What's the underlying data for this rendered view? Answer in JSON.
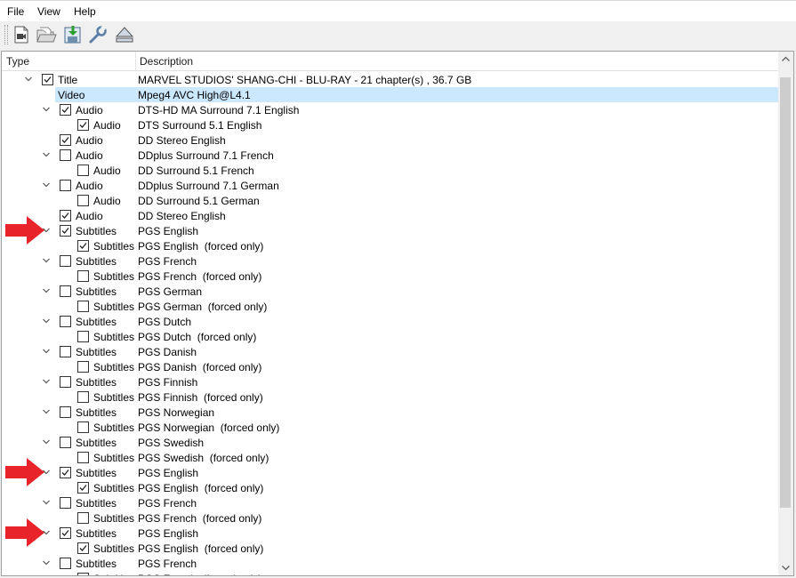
{
  "menubar": {
    "items": [
      {
        "label": "File"
      },
      {
        "label": "View"
      },
      {
        "label": "Help"
      }
    ]
  },
  "toolbar": {
    "buttons": [
      {
        "name": "open-video-file-button",
        "icon": "video-file-icon"
      },
      {
        "name": "open-folder-button",
        "icon": "folder-icon"
      },
      {
        "name": "save-output-button",
        "icon": "save-download-icon"
      },
      {
        "name": "settings-button",
        "icon": "wrench-icon"
      },
      {
        "name": "eject-disc-button",
        "icon": "eject-icon"
      }
    ]
  },
  "tree": {
    "columns": {
      "type": "Type",
      "description": "Description"
    },
    "rows": [
      {
        "level": 0,
        "expander": true,
        "checkbox": true,
        "checked": true,
        "type": "Title",
        "desc": "MARVEL STUDIOS' SHANG-CHI - BLU-RAY - 21 chapter(s) , 36.7 GB"
      },
      {
        "level": 1,
        "expander": false,
        "checkbox": false,
        "checked": false,
        "type": "Video",
        "desc": "Mpeg4 AVC High@L4.1",
        "selected": true
      },
      {
        "level": 1,
        "expander": true,
        "checkbox": true,
        "checked": true,
        "type": "Audio",
        "desc": "DTS-HD MA Surround 7.1 English"
      },
      {
        "level": 2,
        "expander": false,
        "checkbox": true,
        "checked": true,
        "type": "Audio",
        "desc": "DTS Surround 5.1 English"
      },
      {
        "level": 1,
        "expander": false,
        "checkbox": true,
        "checked": true,
        "type": "Audio",
        "desc": "DD Stereo English"
      },
      {
        "level": 1,
        "expander": true,
        "checkbox": true,
        "checked": false,
        "type": "Audio",
        "desc": "DDplus Surround 7.1 French"
      },
      {
        "level": 2,
        "expander": false,
        "checkbox": true,
        "checked": false,
        "type": "Audio",
        "desc": "DD Surround 5.1 French"
      },
      {
        "level": 1,
        "expander": true,
        "checkbox": true,
        "checked": false,
        "type": "Audio",
        "desc": "DDplus Surround 7.1 German"
      },
      {
        "level": 2,
        "expander": false,
        "checkbox": true,
        "checked": false,
        "type": "Audio",
        "desc": "DD Surround 5.1 German"
      },
      {
        "level": 1,
        "expander": false,
        "checkbox": true,
        "checked": true,
        "type": "Audio",
        "desc": "DD Stereo English"
      },
      {
        "level": 1,
        "expander": true,
        "checkbox": true,
        "checked": true,
        "type": "Subtitles",
        "desc": "PGS English"
      },
      {
        "level": 2,
        "expander": false,
        "checkbox": true,
        "checked": true,
        "type": "Subtitles",
        "desc": "PGS English  (forced only)"
      },
      {
        "level": 1,
        "expander": true,
        "checkbox": true,
        "checked": false,
        "type": "Subtitles",
        "desc": "PGS French"
      },
      {
        "level": 2,
        "expander": false,
        "checkbox": true,
        "checked": false,
        "type": "Subtitles",
        "desc": "PGS French  (forced only)"
      },
      {
        "level": 1,
        "expander": true,
        "checkbox": true,
        "checked": false,
        "type": "Subtitles",
        "desc": "PGS German"
      },
      {
        "level": 2,
        "expander": false,
        "checkbox": true,
        "checked": false,
        "type": "Subtitles",
        "desc": "PGS German  (forced only)"
      },
      {
        "level": 1,
        "expander": true,
        "checkbox": true,
        "checked": false,
        "type": "Subtitles",
        "desc": "PGS Dutch"
      },
      {
        "level": 2,
        "expander": false,
        "checkbox": true,
        "checked": false,
        "type": "Subtitles",
        "desc": "PGS Dutch  (forced only)"
      },
      {
        "level": 1,
        "expander": true,
        "checkbox": true,
        "checked": false,
        "type": "Subtitles",
        "desc": "PGS Danish"
      },
      {
        "level": 2,
        "expander": false,
        "checkbox": true,
        "checked": false,
        "type": "Subtitles",
        "desc": "PGS Danish  (forced only)"
      },
      {
        "level": 1,
        "expander": true,
        "checkbox": true,
        "checked": false,
        "type": "Subtitles",
        "desc": "PGS Finnish"
      },
      {
        "level": 2,
        "expander": false,
        "checkbox": true,
        "checked": false,
        "type": "Subtitles",
        "desc": "PGS Finnish  (forced only)"
      },
      {
        "level": 1,
        "expander": true,
        "checkbox": true,
        "checked": false,
        "type": "Subtitles",
        "desc": "PGS Norwegian"
      },
      {
        "level": 2,
        "expander": false,
        "checkbox": true,
        "checked": false,
        "type": "Subtitles",
        "desc": "PGS Norwegian  (forced only)"
      },
      {
        "level": 1,
        "expander": true,
        "checkbox": true,
        "checked": false,
        "type": "Subtitles",
        "desc": "PGS Swedish"
      },
      {
        "level": 2,
        "expander": false,
        "checkbox": true,
        "checked": false,
        "type": "Subtitles",
        "desc": "PGS Swedish  (forced only)"
      },
      {
        "level": 1,
        "expander": true,
        "checkbox": true,
        "checked": true,
        "type": "Subtitles",
        "desc": "PGS English"
      },
      {
        "level": 2,
        "expander": false,
        "checkbox": true,
        "checked": true,
        "type": "Subtitles",
        "desc": "PGS English  (forced only)"
      },
      {
        "level": 1,
        "expander": true,
        "checkbox": true,
        "checked": false,
        "type": "Subtitles",
        "desc": "PGS French"
      },
      {
        "level": 2,
        "expander": false,
        "checkbox": true,
        "checked": false,
        "type": "Subtitles",
        "desc": "PGS French  (forced only)"
      },
      {
        "level": 1,
        "expander": true,
        "checkbox": true,
        "checked": true,
        "type": "Subtitles",
        "desc": "PGS English"
      },
      {
        "level": 2,
        "expander": false,
        "checkbox": true,
        "checked": true,
        "type": "Subtitles",
        "desc": "PGS English  (forced only)"
      },
      {
        "level": 1,
        "expander": true,
        "checkbox": true,
        "checked": false,
        "type": "Subtitles",
        "desc": "PGS French"
      },
      {
        "level": 2,
        "expander": false,
        "checkbox": true,
        "checked": false,
        "type": "Subtitles",
        "desc": "PGS French  (forced only)"
      }
    ]
  },
  "annotations": {
    "arrow_color": "#e8232a",
    "arrow_icon": "red-arrow-icon",
    "rows_pointed": [
      10,
      26,
      30
    ]
  },
  "colors": {
    "selection": "#cce8ff",
    "scroll_thumb": "#cdcdcd"
  }
}
